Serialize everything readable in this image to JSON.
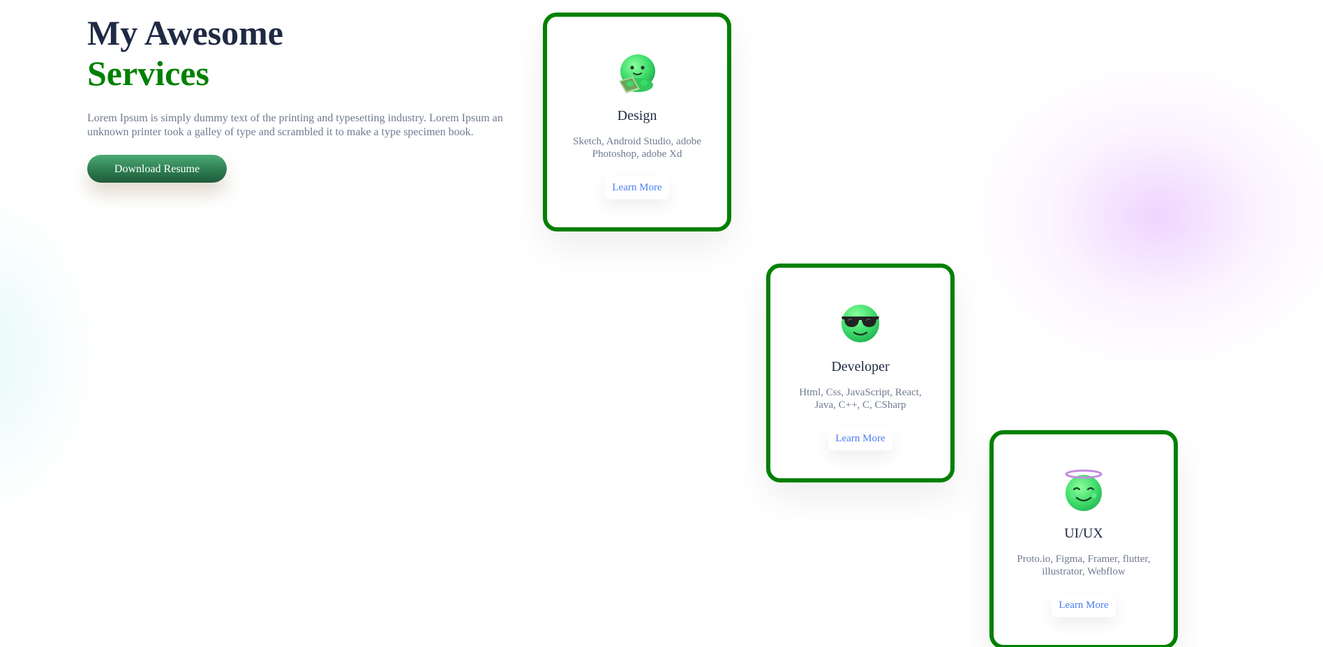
{
  "intro": {
    "title_line1": "My Awesome",
    "title_line2": "Services",
    "description": "Lorem Ipsum is simply dummy text of the printing and typesetting industry. Lorem Ipsum an unknown printer took a galley of type and scrambled it to make a type specimen book.",
    "resume_button": "Download Resume"
  },
  "colors": {
    "accent": "#008000",
    "title": "#1f2a44",
    "body_text": "#707a90",
    "link": "#4a7ef0"
  },
  "cards": [
    {
      "icon": "green-emoji-holding-tablet-icon",
      "title": "Design",
      "description": "Sketch, Android Studio, adobe Photoshop, adobe Xd",
      "link": "Learn More"
    },
    {
      "icon": "green-emoji-sunglasses-icon",
      "title": "Developer",
      "description": "Html, Css, JavaScript, React, Java, C++, C, CSharp",
      "link": "Learn More"
    },
    {
      "icon": "green-emoji-halo-icon",
      "title": "UI/UX",
      "description": "Proto.io, Figma, Framer, flutter, illustrator, Webflow",
      "link": "Learn More"
    }
  ]
}
